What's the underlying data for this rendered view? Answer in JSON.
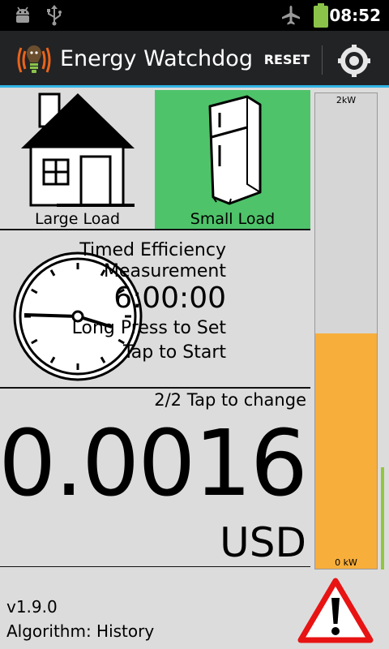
{
  "status_bar": {
    "time": "08:52",
    "icons": [
      "android-debug-icon",
      "usb-icon",
      "airplane-mode-icon",
      "battery-icon"
    ],
    "battery_color": "#8bc34a"
  },
  "action_bar": {
    "app_name": "Energy Watchdog",
    "reset_label": "RESET",
    "logo_icon": "watchdog-logo-icon",
    "settings_icon": "settings-icon",
    "accent_color": "#33b5e5"
  },
  "loads": {
    "large": {
      "label": "Large Load",
      "icon": "house-icon",
      "selected": false
    },
    "small": {
      "label": "Small Load",
      "icon": "fridge-icon",
      "selected": true,
      "selected_color": "#4fc36a"
    }
  },
  "timer": {
    "title_line1": "Timed Efficiency",
    "title_line2": "Measurement",
    "duration": "6:00:00",
    "hint_long_press": "Long Press to Set",
    "hint_tap": "Tap to Start",
    "icon": "clock-icon"
  },
  "cost": {
    "page_indicator": "2/2 Tap to change",
    "value": "0.0016",
    "unit": "USD"
  },
  "meter": {
    "max_label": "2kW",
    "min_label": "0 kW",
    "level_fraction": 0.495,
    "fill_color": "#f8ae3b"
  },
  "footer": {
    "version": "v1.9.0",
    "algorithm": "Algorithm: History",
    "warning_icon": "warning-icon"
  }
}
